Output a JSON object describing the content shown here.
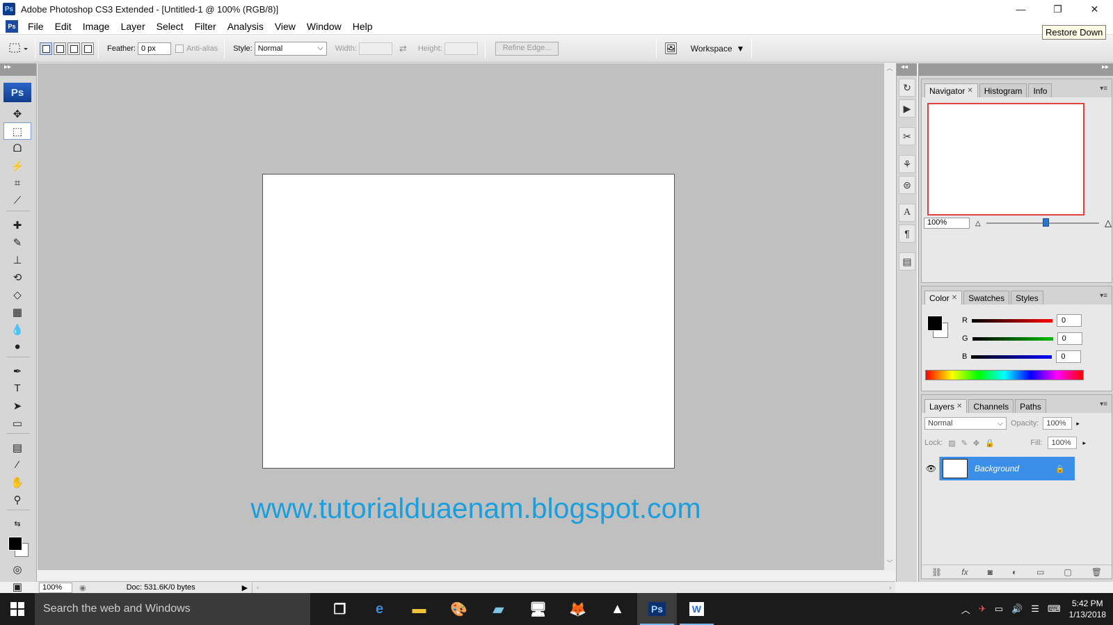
{
  "window": {
    "title": "Adobe Photoshop CS3 Extended - [Untitled-1 @ 100% (RGB/8)]",
    "app_badge": "Ps",
    "tooltip": "Restore Down",
    "controls": {
      "minimize": "—",
      "restore": "❐",
      "close": "✕"
    }
  },
  "menu": {
    "items": [
      "File",
      "Edit",
      "Image",
      "Layer",
      "Select",
      "Filter",
      "Analysis",
      "View",
      "Window",
      "Help"
    ]
  },
  "options": {
    "feather_label": "Feather:",
    "feather_value": "0 px",
    "antialias_label": "Anti-alias",
    "style_label": "Style:",
    "style_value": "Normal",
    "width_label": "Width:",
    "height_label": "Height:",
    "refine_edge_label": "Refine Edge...",
    "workspace_label": "Workspace"
  },
  "toolbox": {
    "logo": "Ps",
    "tools": [
      {
        "name": "move-tool",
        "glyph": "✥"
      },
      {
        "name": "marquee-tool",
        "glyph": "⬚",
        "active": true
      },
      {
        "name": "lasso-tool",
        "glyph": "ᗝ"
      },
      {
        "name": "magic-wand-tool",
        "glyph": "⚡"
      },
      {
        "name": "crop-tool",
        "glyph": "⌗"
      },
      {
        "name": "slice-tool",
        "glyph": "⟋"
      },
      {
        "name": "healing-brush-tool",
        "glyph": "✚"
      },
      {
        "name": "brush-tool",
        "glyph": "✎"
      },
      {
        "name": "clone-stamp-tool",
        "glyph": "⊥"
      },
      {
        "name": "history-brush-tool",
        "glyph": "⟲"
      },
      {
        "name": "eraser-tool",
        "glyph": "◇"
      },
      {
        "name": "gradient-tool",
        "glyph": "▦"
      },
      {
        "name": "blur-tool",
        "glyph": "💧"
      },
      {
        "name": "dodge-tool",
        "glyph": "●"
      },
      {
        "name": "pen-tool",
        "glyph": "✒"
      },
      {
        "name": "type-tool",
        "glyph": "T"
      },
      {
        "name": "path-selection-tool",
        "glyph": "➤"
      },
      {
        "name": "rectangle-tool",
        "glyph": "▭"
      },
      {
        "name": "notes-tool",
        "glyph": "▤"
      },
      {
        "name": "eyedropper-tool",
        "glyph": "⁄"
      },
      {
        "name": "hand-tool",
        "glyph": "✋"
      },
      {
        "name": "zoom-tool",
        "glyph": "⚲"
      }
    ]
  },
  "document": {
    "watermark": "www.tutorialduaenam.blogspot.com",
    "zoom": "100%",
    "doc_info": "Doc: 531.6K/0 bytes"
  },
  "navigator_panel": {
    "tabs": [
      "Navigator",
      "Histogram",
      "Info"
    ],
    "zoom_value": "100%"
  },
  "color_panel": {
    "tabs": [
      "Color",
      "Swatches",
      "Styles"
    ],
    "channels": [
      {
        "label": "R",
        "value": "0",
        "color": "#ff0000"
      },
      {
        "label": "G",
        "value": "0",
        "color": "#00c000"
      },
      {
        "label": "B",
        "value": "0",
        "color": "#0000ff"
      }
    ]
  },
  "layers_panel": {
    "tabs": [
      "Layers",
      "Channels",
      "Paths"
    ],
    "blend_mode": "Normal",
    "opacity_label": "Opacity:",
    "opacity_value": "100%",
    "lock_label": "Lock:",
    "fill_label": "Fill:",
    "fill_value": "100%",
    "layer_name": "Background"
  },
  "taskbar": {
    "search_placeholder": "Search the web and Windows",
    "time": "5:42 PM",
    "date": "1/13/2018",
    "apps": [
      {
        "name": "task-view-icon",
        "glyph": "❐"
      },
      {
        "name": "edge-icon",
        "glyph": "e",
        "color": "#3a8be0"
      },
      {
        "name": "file-explorer-icon",
        "glyph": "▬",
        "color": "#f3c23b"
      },
      {
        "name": "paint-icon",
        "glyph": "🎨"
      },
      {
        "name": "notepad-icon",
        "glyph": "▰",
        "color": "#7fc4e0"
      },
      {
        "name": "remote-desktop-icon",
        "glyph": "🖥"
      },
      {
        "name": "firefox-icon",
        "glyph": "🦊"
      },
      {
        "name": "photos-icon",
        "glyph": "▲",
        "color": "#ffffff"
      },
      {
        "name": "photoshop-icon",
        "glyph": "Ps",
        "color": "#9fd0ff",
        "active": true
      },
      {
        "name": "word-icon",
        "glyph": "W",
        "color": "#2b6dd2",
        "open": true
      }
    ]
  },
  "colors": {
    "canvas_bg": "#c0c0c0",
    "watermark": "#1a9fde",
    "layer_selected": "#3b8fe8",
    "navigator_view_box": "#e34141"
  }
}
